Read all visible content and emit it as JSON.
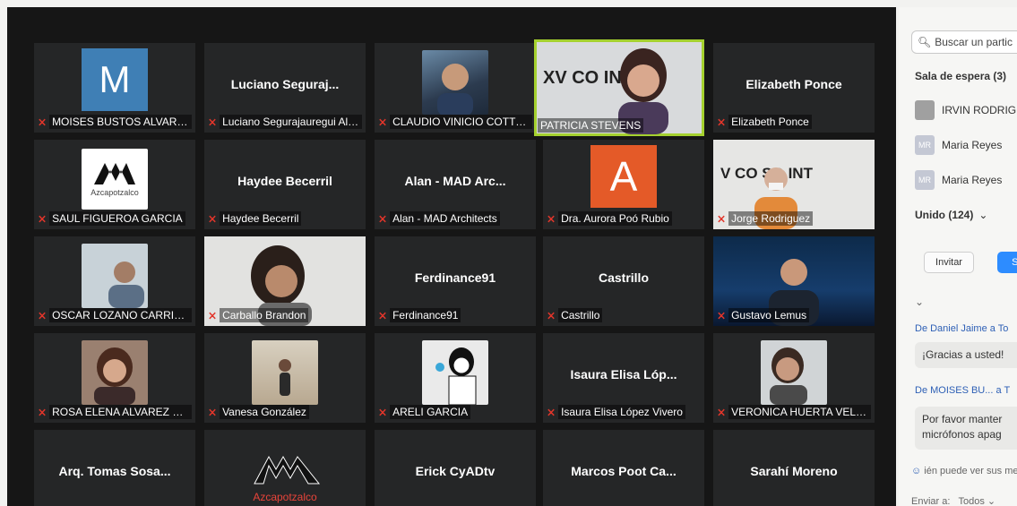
{
  "participants": {
    "moises": {
      "initial": "M",
      "label": "MOISES BUSTOS ALVAREZ"
    },
    "luciano": {
      "big": "Luciano Seguraj...",
      "label": "Luciano Segurajauregui Alv..."
    },
    "claudio": {
      "label": "CLAUDIO VINICIO COTTO A..."
    },
    "patricia": {
      "label": "PATRICIA STEVENS",
      "banner": "XV CO INTE"
    },
    "elizabeth": {
      "big": "Elizabeth Ponce",
      "label": "Elizabeth Ponce"
    },
    "saul": {
      "logo_text": "Azcapotzalco",
      "label": "SAUL FIGUEROA GARCIA"
    },
    "haydee": {
      "big": "Haydee Becerril",
      "label": "Haydee Becerril"
    },
    "alan": {
      "big": "Alan - MAD Arc...",
      "label": "Alan - MAD Architects"
    },
    "aurora": {
      "initial": "A",
      "label": "Dra. Aurora Poó Rubio"
    },
    "jorge": {
      "label": "Jorge Rodriguez",
      "banner": "V CO SO INT"
    },
    "oscar": {
      "label": "OSCAR LOZANO CARRILLO"
    },
    "carballo": {
      "label": "Carballo Brandon"
    },
    "ferdinance": {
      "big": "Ferdinance91",
      "label": "Ferdinance91"
    },
    "castrillo": {
      "big": "Castrillo",
      "label": "Castrillo"
    },
    "gustavo": {
      "label": "Gustavo Lemus"
    },
    "rosa": {
      "label": "ROSA ELENA ALVAREZ MA..."
    },
    "vanesa": {
      "label": "Vanesa González"
    },
    "areli": {
      "label": "ARELI GARCIA"
    },
    "isaura": {
      "big": "Isaura Elisa Lóp...",
      "label": "Isaura Elisa López Vivero"
    },
    "veronica": {
      "label": "VERONICA HUERTA VELAZ..."
    },
    "tomas": {
      "big": "Arq. Tomas Sosa..."
    },
    "azca2": {
      "logo_text": "Azcapotzalco"
    },
    "erick": {
      "big": "Erick CyADtv"
    },
    "marcos": {
      "big": "Marcos Poot Ca..."
    },
    "sarahi": {
      "big": "Sarahí Moreno"
    }
  },
  "colors": {
    "mute": "#e2352a",
    "active_border": "#a5d12f",
    "moises_avatar": "#3f7fb5",
    "aurora_avatar": "#e45a28"
  },
  "sidebar": {
    "search_placeholder": "Buscar un partic",
    "waiting_room": "Sala de espera (3)",
    "waiting": [
      {
        "name": "IRVIN RODRIG",
        "avatar": ""
      },
      {
        "name": "Maria Reyes",
        "avatar": "MR"
      },
      {
        "name": "Maria Reyes",
        "avatar": "MR"
      }
    ],
    "joined": "Unido (124)",
    "invite": "Invitar",
    "mute_btn": "Si",
    "chat": [
      {
        "meta": "De Daniel Jaime a To",
        "text": "¡Gracias a usted!"
      },
      {
        "meta": "De MOISES BU...  a T",
        "text": "Por favor manter micrófonos apag"
      }
    ],
    "who_can_see": "ién puede ver sus me",
    "send_to": "Enviar a:",
    "send_to_value": "Todos"
  }
}
